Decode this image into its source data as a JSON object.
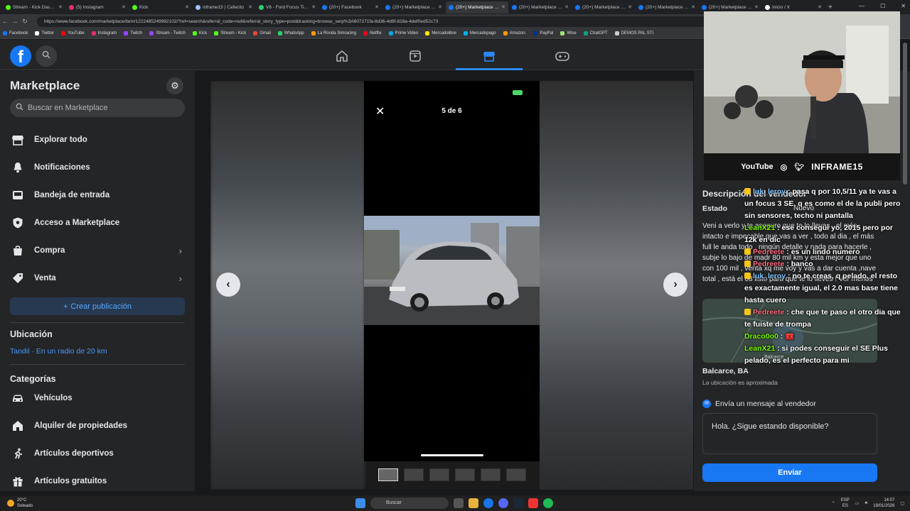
{
  "browser": {
    "tabs": [
      {
        "label": "Stream - Kick Dashbo",
        "color": "#53fc18"
      },
      {
        "label": "(5) Instagram",
        "color": "#e1306c"
      },
      {
        "label": "Kick",
        "color": "#53fc18"
      },
      {
        "label": "inframe15 | Cafecito",
        "color": "#a0c4ff"
      },
      {
        "label": "V6 - Ford Focus Titani",
        "color": "#2ecc71"
      },
      {
        "label": "(20+) Facebook",
        "color": "#1877f2"
      },
      {
        "label": "(20+) Marketplace - F",
        "color": "#1877f2"
      },
      {
        "label": "(20+) Marketplace - F",
        "color": "#1877f2",
        "active": true
      },
      {
        "label": "(20+) Marketplace - 2",
        "color": "#1877f2"
      },
      {
        "label": "(20+) Marketplace - F",
        "color": "#1877f2"
      },
      {
        "label": "(20+) Marketplace - F",
        "color": "#1877f2"
      },
      {
        "label": "(20+) Marketplace - F",
        "color": "#1877f2"
      },
      {
        "label": "Inicio / X",
        "color": "#ffffff"
      }
    ],
    "url": "https://www.facebook.com/marketplace/item/1222485249982102/?ref=search&referral_code=null&referral_story_type=post&tracking=browse_serp%3A607271fa-8d36-4d9f-818a-4def0ed52c73",
    "bookmarks": [
      {
        "label": "Facebook",
        "color": "#1877f2"
      },
      {
        "label": "Twitter",
        "color": "#ffffff"
      },
      {
        "label": "YouTube",
        "color": "#ff0000"
      },
      {
        "label": "Instagram",
        "color": "#e1306c"
      },
      {
        "label": "Twitch",
        "color": "#9146ff"
      },
      {
        "label": "Stream - Twitch",
        "color": "#9146ff"
      },
      {
        "label": "Kick",
        "color": "#53fc18"
      },
      {
        "label": "Stream - Kick",
        "color": "#53fc18"
      },
      {
        "label": "Gmail",
        "color": "#ea4335"
      },
      {
        "label": "WhatsApp",
        "color": "#25d366"
      },
      {
        "label": "La Ronda Simracing",
        "color": "#ff9900"
      },
      {
        "label": "Netflix",
        "color": "#e50914"
      },
      {
        "label": "Prime Video",
        "color": "#00a8e1"
      },
      {
        "label": "Mercadolibre",
        "color": "#ffe600"
      },
      {
        "label": "Mercadopago",
        "color": "#00b1ea"
      },
      {
        "label": "Amazon.",
        "color": "#ff9900"
      },
      {
        "label": "PayPal",
        "color": "#003087"
      },
      {
        "label": "Wise",
        "color": "#9fe870"
      },
      {
        "label": "ChatGPT",
        "color": "#10a37f"
      },
      {
        "label": "DEMOS PAL STI",
        "color": "#cccccc"
      }
    ]
  },
  "sidebar": {
    "title": "Marketplace",
    "search_placeholder": "Buscar en Marketplace",
    "items": [
      {
        "label": "Explorar todo",
        "icon": "storefront-icon"
      },
      {
        "label": "Notificaciones",
        "icon": "bell-icon"
      },
      {
        "label": "Bandeja de entrada",
        "icon": "inbox-icon"
      },
      {
        "label": "Acceso a Marketplace",
        "icon": "shield-icon"
      },
      {
        "label": "Compra",
        "icon": "bag-icon",
        "chevron": true
      },
      {
        "label": "Venta",
        "icon": "tag-icon",
        "chevron": true
      }
    ],
    "create_label": "Crear publicación",
    "location_title": "Ubicación",
    "location_value": "Tandil · En un radio de 20 km",
    "categories_title": "Categorías",
    "categories": [
      {
        "label": "Vehículos",
        "icon": "car-icon"
      },
      {
        "label": "Alquiler de propiedades",
        "icon": "home-icon"
      },
      {
        "label": "Artículos deportivos",
        "icon": "sport-icon"
      },
      {
        "label": "Artículos gratuitos",
        "icon": "gift-icon"
      }
    ]
  },
  "viewer": {
    "counter": "5 de 6",
    "thumbnail_count": 6,
    "active_thumbnail": 0
  },
  "stream": {
    "socials": [
      "YouTube",
      "INFRAME15"
    ]
  },
  "listing": {
    "description_title": "Descripción del vendedor",
    "estado_label": "Estado",
    "estado_value": "Nuevo",
    "description": "Veni a verlo y te aseguro que te lo llevas , el más intacto e impecable que vas a ver , todo al dia , el más full le anda todo , ningún detalle y nada para hacerle , subje lo bajo de madr 80 mil km y esta mejor que uno con 100 mil , venta xq me voy y vas a dar cuenta ,nave total , está el 08 listo para que te lo lleves ! Ver menos",
    "location": "Balcarce, BA",
    "location_note": "La ubicación es aproximada",
    "map_label": "Balcarce"
  },
  "chat": [
    {
      "user": "luk_leroy",
      "color": "#7fc7ff",
      "badge": "#f5c518",
      "text": "pasa q por 10,5/11 ya te vas a un focus 3 SE, q es como el de la publi pero sin sensores, techo ni pantalla"
    },
    {
      "user": "LeanX21",
      "color": "#7CFC00",
      "badge": "",
      "text": "ese consegui yo, 2015 pero por 12k en dic"
    },
    {
      "user": "Pedreete",
      "color": "#ff6b81",
      "badge": "#f5c518",
      "text": "es un lindo numero"
    },
    {
      "user": "Pedreete",
      "color": "#ff6b81",
      "badge": "#f5c518",
      "text": "banco"
    },
    {
      "user": "luk_leroy",
      "color": "#7fc7ff",
      "badge": "#f5c518",
      "text": "no te creas, q pelado, el resto es exactamente igual, el 2.0 mas base tiene hasta cuero"
    },
    {
      "user": "Pedreete",
      "color": "#ff6b81",
      "badge": "#f5c518",
      "text": "che que te paso el otro dia que te fuiste de trompa"
    },
    {
      "user": "Draco0o0",
      "color": "#7CFC00",
      "badge": "",
      "text": "🧰"
    },
    {
      "user": "LeanX21",
      "color": "#7CFC00",
      "badge": "",
      "text": "si podes conseguir el SE Plus pelado, es el perfecto para mi"
    }
  ],
  "message": {
    "header": "Envía un mensaje al vendedor",
    "text": "Hola. ¿Sigue estando disponible?",
    "send_label": "Enviar"
  },
  "taskbar": {
    "temp": "20°C",
    "weather": "Soleado",
    "search": "Buscar",
    "lang": "ESP",
    "region": "ES",
    "time": "14:07",
    "date": "19/01/2026"
  }
}
